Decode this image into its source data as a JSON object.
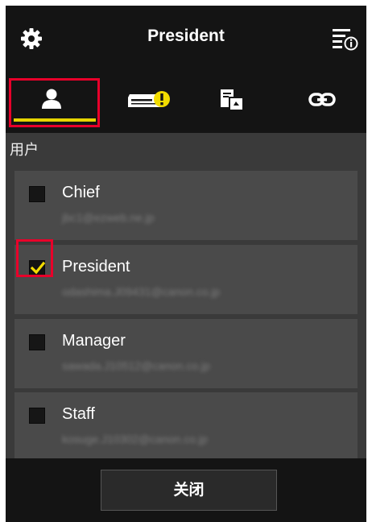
{
  "header": {
    "title": "President",
    "left_icon": "gear-icon",
    "right_icon": "menu-info-icon"
  },
  "tabs": [
    {
      "icon": "user-icon",
      "active": true
    },
    {
      "icon": "printer-warning-icon",
      "active": false
    },
    {
      "icon": "scan-to-cloud-icon",
      "active": false
    },
    {
      "icon": "link-icon",
      "active": false
    }
  ],
  "section_label": "用户",
  "users": [
    {
      "name": "Chief",
      "email": "jbc1@ezweb.ne.jp",
      "checked": false
    },
    {
      "name": "President",
      "email": "odashima.J09431@canon.co.jp",
      "checked": true
    },
    {
      "name": "Manager",
      "email": "sawada.J10512@canon.co.jp",
      "checked": false
    },
    {
      "name": "Staff",
      "email": "kosuge.J10302@canon.co.jp",
      "checked": false
    }
  ],
  "footer": {
    "close_label": "关闭"
  },
  "colors": {
    "accent_underline": "#e6d400",
    "check_mark": "#f2dc00",
    "highlight_box": "#e8002a",
    "warning_badge": "#f2dc00"
  }
}
